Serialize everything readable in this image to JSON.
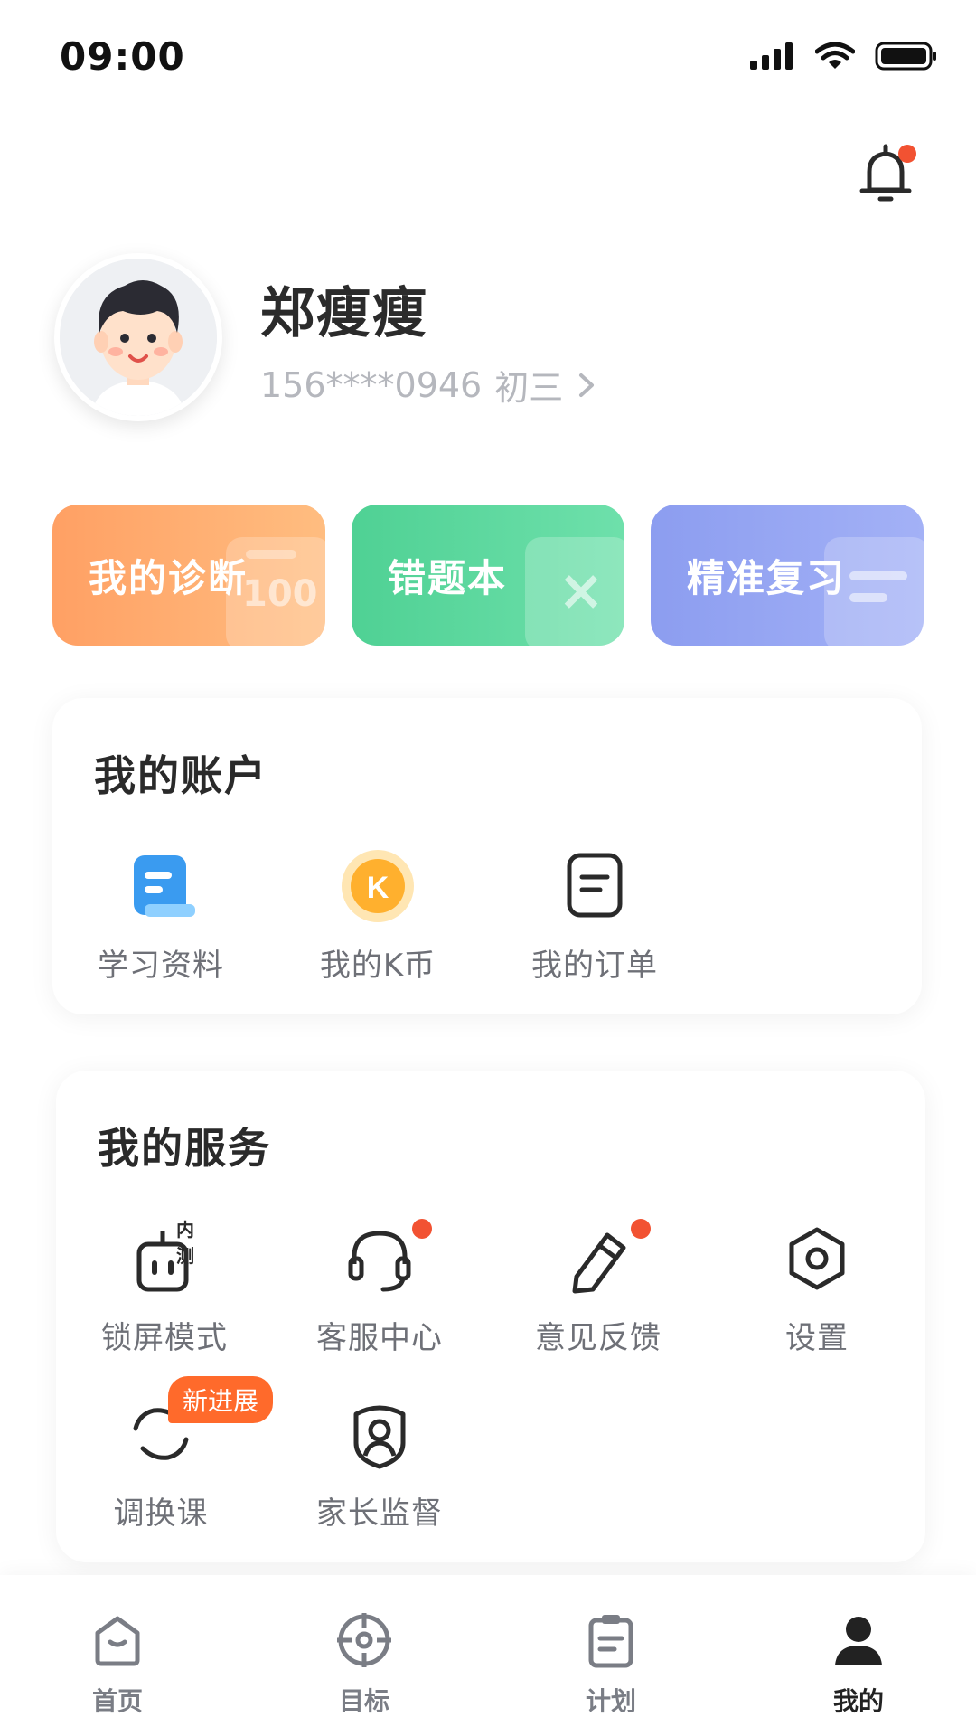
{
  "status": {
    "time": "09:00"
  },
  "profile": {
    "name": "郑瘦瘦",
    "phone": "156****0946",
    "grade": "初三"
  },
  "quick_cards": [
    {
      "label": "我的诊断",
      "deco_text": "100",
      "color": "#ffa064"
    },
    {
      "label": "错题本",
      "deco_text": "×",
      "color": "#4fd194"
    },
    {
      "label": "精准复习",
      "color": "#8c9df0"
    }
  ],
  "account": {
    "title": "我的账户",
    "items": [
      {
        "label": "学习资料",
        "icon": "document-icon"
      },
      {
        "label": "我的K币",
        "icon": "k-coin-icon",
        "coin_letter": "K"
      },
      {
        "label": "我的订单",
        "icon": "order-icon"
      }
    ]
  },
  "services": {
    "title": "我的服务",
    "items": [
      {
        "label": "锁屏模式",
        "icon": "robot-lock-icon",
        "tag": "内测"
      },
      {
        "label": "客服中心",
        "icon": "headset-icon"
      },
      {
        "label": "意见反馈",
        "icon": "pencil-icon"
      },
      {
        "label": "设置",
        "icon": "settings-icon"
      },
      {
        "label": "调换课",
        "icon": "swap-icon",
        "badge": "新进展"
      },
      {
        "label": "家长监督",
        "icon": "parent-shield-icon"
      }
    ]
  },
  "tabs": [
    {
      "label": "首页",
      "icon": "home-icon"
    },
    {
      "label": "目标",
      "icon": "target-icon"
    },
    {
      "label": "计划",
      "icon": "clipboard-icon"
    },
    {
      "label": "我的",
      "icon": "user-icon"
    }
  ],
  "colors": {
    "accent_red": "#f25232",
    "badge_orange": "#ff6a2b"
  }
}
